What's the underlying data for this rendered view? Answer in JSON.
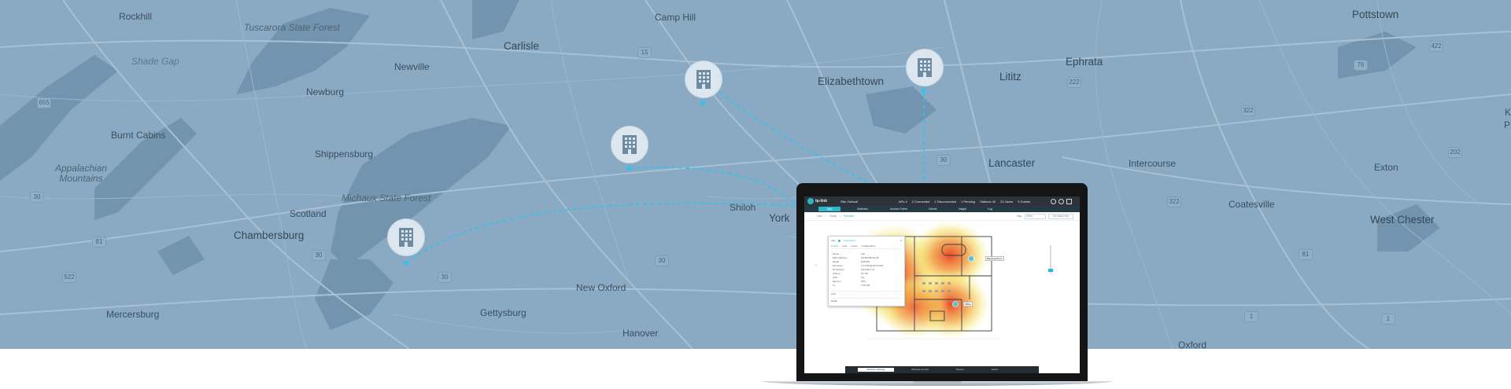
{
  "map": {
    "towns": [
      {
        "id": "rockhill",
        "name": "Rockhill"
      },
      {
        "id": "tuscarora",
        "name": "Tuscarora State Forest"
      },
      {
        "id": "shade-gap",
        "name": "Shade Gap"
      },
      {
        "id": "camp-hill",
        "name": "Camp Hill"
      },
      {
        "id": "carlisle",
        "name": "Carlisle"
      },
      {
        "id": "newville",
        "name": "Newville"
      },
      {
        "id": "newburg",
        "name": "Newburg"
      },
      {
        "id": "burnt-cabins",
        "name": "Burnt Cabins"
      },
      {
        "id": "shippensburg",
        "name": "Shippensburg"
      },
      {
        "id": "appalachian",
        "name": "Appalachian Mountains"
      },
      {
        "id": "michaux",
        "name": "Michaux State Forest"
      },
      {
        "id": "scotland",
        "name": "Scotland"
      },
      {
        "id": "chambersburg",
        "name": "Chambersburg"
      },
      {
        "id": "mercersburg",
        "name": "Mercersburg"
      },
      {
        "id": "new-oxford",
        "name": "New Oxford"
      },
      {
        "id": "gettysburg",
        "name": "Gettysburg"
      },
      {
        "id": "hanover",
        "name": "Hanover"
      },
      {
        "id": "shiloh",
        "name": "Shiloh"
      },
      {
        "id": "york",
        "name": "York"
      },
      {
        "id": "elizabethtown",
        "name": "Elizabethtown"
      },
      {
        "id": "lititz",
        "name": "Lititz"
      },
      {
        "id": "ephrata",
        "name": "Ephrata"
      },
      {
        "id": "lancaster",
        "name": "Lancaster"
      },
      {
        "id": "intercourse",
        "name": "Intercourse"
      },
      {
        "id": "pottstown",
        "name": "Pottstown"
      },
      {
        "id": "exton",
        "name": "Exton"
      },
      {
        "id": "coatesville",
        "name": "Coatesville"
      },
      {
        "id": "west-chester",
        "name": "West Chester"
      },
      {
        "id": "oxford",
        "name": "Oxford"
      },
      {
        "id": "edge-k",
        "name": "K"
      },
      {
        "id": "edge-p",
        "name": "P"
      }
    ],
    "routes": [
      "655",
      "15",
      "30",
      "81",
      "322",
      "222",
      "422",
      "76",
      "522",
      "30",
      "30",
      "30",
      "322",
      "30",
      "202",
      "30",
      "30",
      "1",
      "1",
      "81"
    ],
    "colors": {
      "land": "#8aa9c2",
      "road": "#a6bfd2",
      "link": "#2ec4ee",
      "marker": "#dbe6ef"
    }
  },
  "screen": {
    "brand": "tp-link",
    "site_selector": "Site: Default",
    "stats": [
      {
        "label": "APs",
        "value": "4"
      },
      {
        "label": "Connected",
        "value": "2"
      },
      {
        "label": "Disconnected",
        "value": "1"
      },
      {
        "label": "Pending",
        "value": "1"
      },
      {
        "label": "Stations",
        "value": "40"
      },
      {
        "label": "Users",
        "value": "20"
      },
      {
        "label": "Guests",
        "value": "3"
      }
    ],
    "tabs": [
      {
        "label": "Map",
        "active": true
      },
      {
        "label": "Statistics"
      },
      {
        "label": "Access Points"
      },
      {
        "label": "Clients"
      },
      {
        "label": "Insight"
      },
      {
        "label": "Log"
      }
    ],
    "breadcrumb": [
      "Lists",
      "Global",
      "Floorplan"
    ],
    "map_select_label": "Map",
    "map_select_value": "Office",
    "map_button": "Get Back Here",
    "panel": {
      "title": "Lab",
      "status": "Connected",
      "tabs": [
        "Details",
        "User",
        "Guest",
        "Configuration"
      ],
      "rows": [
        {
          "k": "Name",
          "v": "Lab"
        },
        {
          "k": "MAC Address",
          "v": "A0-5B-DB-3A-8F"
        },
        {
          "k": "Model",
          "v": "EAP245"
        },
        {
          "k": "Firmware",
          "v": "1.0.0 Build 20170124"
        },
        {
          "k": "IP Address",
          "v": "192.168.1.11"
        },
        {
          "k": "Uptime",
          "v": "3d 10h"
        },
        {
          "k": "CPU",
          "v": "2%"
        },
        {
          "k": "Memory",
          "v": "45%"
        },
        {
          "k": "Tx",
          "v": "1.56 GB"
        }
      ],
      "sections": [
        "LAN",
        "Radio"
      ]
    },
    "ap_labels": [
      "Meeting Room",
      "Office"
    ],
    "bottom_buttons": [
      {
        "label": "Wireless Settings",
        "active": true
      },
      {
        "label": "Wireless Control"
      },
      {
        "label": "System"
      },
      {
        "label": "Admin"
      }
    ],
    "colors": {
      "topbar": "#2d3338",
      "tabbar": "#243a44",
      "accent": "#2fb6c8",
      "ap": "#4fc3dd"
    }
  }
}
